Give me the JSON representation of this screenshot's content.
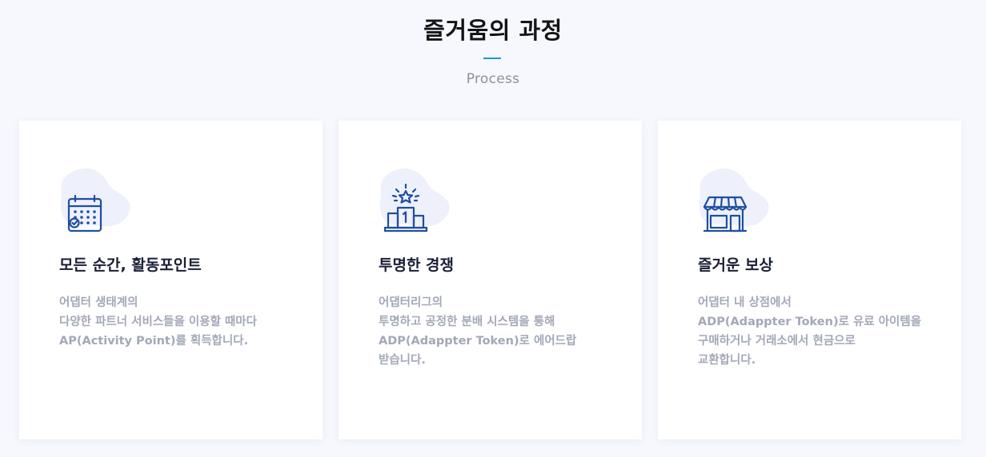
{
  "section": {
    "title": "즐거움의 과정",
    "subtitle": "Process",
    "accent_color": "#1d97c9",
    "icon_color": "#1f4ea3",
    "blob_color": "#eef1fb"
  },
  "cards": [
    {
      "icon": "calendar-check-icon",
      "title": "모든 순간, 활동포인트",
      "desc": [
        "어댑터 생태계의",
        "다양한 파트너 서비스들을 이용할 때마다",
        "AP(Activity Point)를 획득합니다."
      ]
    },
    {
      "icon": "podium-star-icon",
      "title": "투명한 경쟁",
      "desc": [
        "어댑터리그의",
        "투명하고 공정한 분배 시스템을 통해",
        "ADP(Adappter Token)로 에어드랍",
        "받습니다."
      ]
    },
    {
      "icon": "storefront-icon",
      "title": "즐거운 보상",
      "desc": [
        "어댑터 내 상점에서",
        "ADP(Adappter Token)로 유료 아이템을",
        "구매하거나 거래소에서 현금으로",
        "교환합니다."
      ]
    }
  ]
}
